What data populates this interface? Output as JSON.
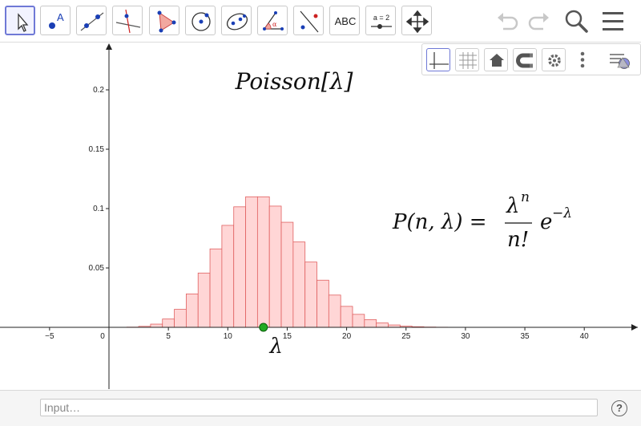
{
  "toolbar": {
    "tools": [
      {
        "name": "move-tool",
        "icon": "cursor-arrow-icon",
        "selected": true
      },
      {
        "name": "point-tool",
        "icon": "point-icon",
        "label": "A"
      },
      {
        "name": "line-tool",
        "icon": "line-through-two-points-icon"
      },
      {
        "name": "perpendicular-line-tool",
        "icon": "perpendicular-line-icon"
      },
      {
        "name": "polygon-tool",
        "icon": "polygon-icon"
      },
      {
        "name": "circle-center-point-tool",
        "icon": "circle-with-center-icon"
      },
      {
        "name": "ellipse-tool",
        "icon": "ellipse-icon"
      },
      {
        "name": "angle-tool",
        "icon": "angle-icon",
        "label": "α"
      },
      {
        "name": "reflect-tool",
        "icon": "reflect-about-line-icon"
      },
      {
        "name": "text-tool",
        "icon": "text-icon",
        "label": "ABC"
      },
      {
        "name": "slider-tool",
        "icon": "slider-icon",
        "label": "a = 2"
      },
      {
        "name": "move-graphics-view-tool",
        "icon": "move-arrows-icon"
      }
    ],
    "undo_icon": "undo-icon",
    "redo_icon": "redo-icon",
    "search_icon": "search-icon",
    "menu_icon": "hamburger-menu-icon"
  },
  "graphics_style_bar": [
    {
      "name": "toggle-axes",
      "icon": "axes-icon",
      "active": true
    },
    {
      "name": "toggle-grid",
      "icon": "grid-icon"
    },
    {
      "name": "standard-view",
      "icon": "home-icon"
    },
    {
      "name": "point-capturing",
      "icon": "magnet-icon"
    },
    {
      "name": "graphics-settings",
      "icon": "gear-icon"
    },
    {
      "name": "more-options",
      "icon": "vertical-dots-icon"
    },
    {
      "name": "style-bar-toggle",
      "icon": "style-bar-icon"
    }
  ],
  "graph": {
    "title": "Poisson[λ]",
    "formula": {
      "lhs": "P(n, λ) =",
      "num": "λ",
      "num_exp": "n",
      "den": "n!",
      "exp_base": "e",
      "exp_power": "−λ"
    },
    "point_label": "λ",
    "lambda": 13,
    "x_ticks": [
      "−5",
      "0",
      "5",
      "10",
      "15",
      "20",
      "25",
      "30",
      "35",
      "40"
    ],
    "x_tick_values": [
      -5,
      0,
      5,
      10,
      15,
      20,
      25,
      30,
      35,
      40
    ],
    "y_ticks": [
      "0.05",
      "0.1",
      "0.15",
      "0.2"
    ],
    "y_tick_values": [
      0.05,
      0.1,
      0.15,
      0.2
    ],
    "bar_fill": "#ffd6d6",
    "bar_stroke": "#e06060",
    "point_color": "#22aa22"
  },
  "input_bar": {
    "placeholder": "Input…",
    "help_label": "?"
  }
}
